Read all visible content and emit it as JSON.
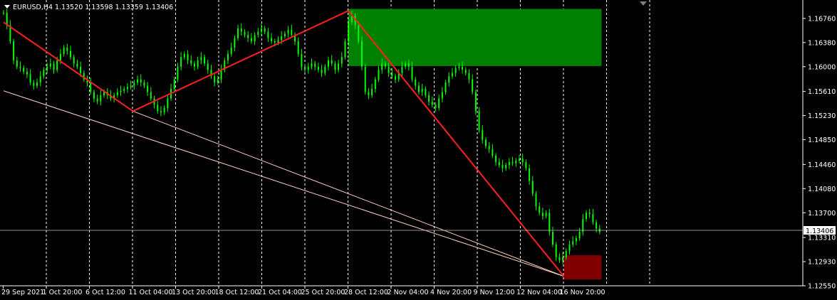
{
  "header": {
    "symbol": "EURUSD,H4",
    "ohlc": "1.13520 1.13598 1.13359 1.13406"
  },
  "colors": {
    "background": "#000000",
    "candle": "#00ff00",
    "grid": "#ffffff",
    "trendline": "#ff2020",
    "fan_line": "#ffd0c0",
    "zone_upper": "#008000",
    "zone_lower": "#800000",
    "price_line": "#c0c0c0"
  },
  "chart_data": {
    "type": "candlestick",
    "symbol": "EURUSD",
    "timeframe": "H4",
    "last_price": 1.13406,
    "ylim": [
      1.1255,
      1.1705
    ],
    "y_ticks": [
      "1.16760",
      "1.16380",
      "1.16000",
      "1.15610",
      "1.15230",
      "1.14850",
      "1.14460",
      "1.14080",
      "1.13700",
      "1.13310",
      "1.12930",
      "1.12550"
    ],
    "x_ticks": [
      "29 Sep 2021",
      "1 Oct 20:00",
      "6 Oct 12:00",
      "11 Oct 04:00",
      "13 Oct 20:00",
      "18 Oct 12:00",
      "21 Oct 04:00",
      "25 Oct 20:00",
      "28 Oct 12:00",
      "2 Nov 04:00",
      "4 Nov 20:00",
      "9 Nov 12:00",
      "12 Nov 04:00",
      "16 Nov 20:00"
    ],
    "closes": [
      1.1685,
      1.1665,
      1.164,
      1.161,
      1.16,
      1.1598,
      1.1592,
      1.1588,
      1.1575,
      1.157,
      1.1575,
      1.1585,
      1.1595,
      1.16,
      1.1605,
      1.1595,
      1.161,
      1.162,
      1.163,
      1.1625,
      1.1615,
      1.1605,
      1.16,
      1.159,
      1.158,
      1.1575,
      1.156,
      1.155,
      1.1545,
      1.1555,
      1.156,
      1.1555,
      1.155,
      1.1555,
      1.156,
      1.1562,
      1.1565,
      1.1568,
      1.157,
      1.1575,
      1.158,
      1.1575,
      1.157,
      1.156,
      1.155,
      1.154,
      1.153,
      1.1528,
      1.1535,
      1.155,
      1.1565,
      1.158,
      1.16,
      1.1615,
      1.162,
      1.161,
      1.1605,
      1.16,
      1.161,
      1.1615,
      1.1605,
      1.1595,
      1.1585,
      1.1575,
      1.158,
      1.1595,
      1.161,
      1.162,
      1.163,
      1.1645,
      1.166,
      1.1655,
      1.165,
      1.1645,
      1.164,
      1.165,
      1.1655,
      1.166,
      1.1655,
      1.1645,
      1.164,
      1.1638,
      1.1642,
      1.1648,
      1.1652,
      1.1658,
      1.165,
      1.164,
      1.162,
      1.16,
      1.1595,
      1.16,
      1.1605,
      1.16,
      1.1595,
      1.159,
      1.16,
      1.161,
      1.1605,
      1.1595,
      1.1605,
      1.1615,
      1.164,
      1.167,
      1.168,
      1.1665,
      1.164,
      1.16,
      1.156,
      1.1555,
      1.1565,
      1.158,
      1.1595,
      1.1605,
      1.16,
      1.159,
      1.1585,
      1.158,
      1.159,
      1.16,
      1.1605,
      1.16,
      1.158,
      1.157,
      1.156,
      1.1565,
      1.1555,
      1.1545,
      1.154,
      1.1535,
      1.155,
      1.156,
      1.1575,
      1.1585,
      1.159,
      1.1598,
      1.16,
      1.1595,
      1.159,
      1.158,
      1.156,
      1.153,
      1.15,
      1.1485,
      1.1475,
      1.147,
      1.146,
      1.145,
      1.1445,
      1.144,
      1.1445,
      1.145,
      1.1448,
      1.1452,
      1.1455,
      1.145,
      1.144,
      1.142,
      1.14,
      1.138,
      1.137,
      1.1365,
      1.137,
      1.134,
      1.132,
      1.13,
      1.1295,
      1.13,
      1.131,
      1.132,
      1.1325,
      1.133,
      1.134,
      1.136,
      1.137,
      1.1368,
      1.1355,
      1.1345,
      1.134
    ],
    "trendlines": [
      {
        "from": [
          "29 Sep 2021",
          1.167
        ],
        "to": [
          "11 Oct 04:00",
          1.153
        ]
      },
      {
        "from": [
          "11 Oct 04:00",
          1.153
        ],
        "to": [
          "28 Oct 12:00",
          1.1688
        ]
      },
      {
        "from": [
          "28 Oct 12:00",
          1.1688
        ],
        "to": [
          "16 Nov 20:00",
          1.127
        ]
      }
    ],
    "fan_lines": [
      {
        "from": [
          "29 Sep 2021",
          1.1562
        ],
        "to": [
          "16 Nov 20:00",
          1.127
        ]
      },
      {
        "from": [
          "11 Oct 04:00",
          1.153
        ],
        "to": [
          "16 Nov 20:00",
          1.127
        ]
      }
    ],
    "zones": [
      {
        "name": "upper",
        "from": "28 Oct 12:00",
        "to": "after 16 Nov 20:00",
        "high": 1.1691,
        "low": 1.1601
      },
      {
        "name": "lower",
        "from": "16 Nov 20:00",
        "to": "after 16 Nov 20:00",
        "high": 1.1303,
        "low": 1.1265
      }
    ]
  }
}
